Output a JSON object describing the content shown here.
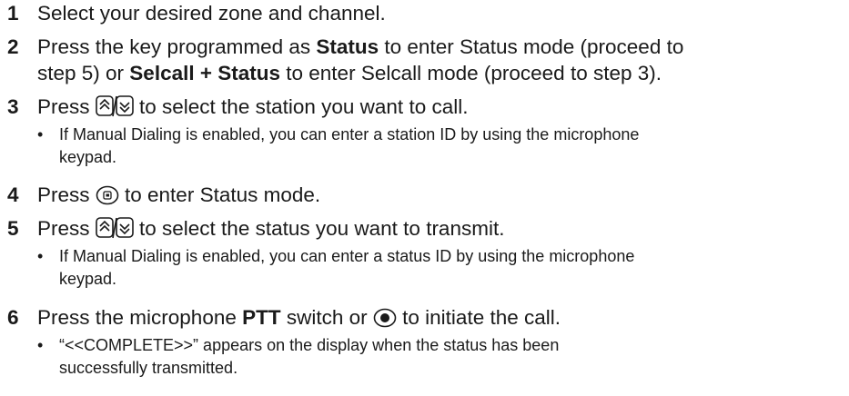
{
  "steps": [
    {
      "num": "1",
      "before": "Select your desired zone and channel."
    },
    {
      "num": "2",
      "before": "Press the key programmed as ",
      "bold1": "Status",
      "mid": " to enter Status mode (proceed to",
      "line2a": "step 5) or ",
      "bold2": "Selcall + Status",
      "line2b": " to enter Selcall mode (proceed to step 3)."
    },
    {
      "num": "3",
      "before": "Press ",
      "after": " to select the station you want to call.",
      "sub_line1": "If Manual Dialing is enabled, you can enter a station ID by using the microphone",
      "sub_line2": "keypad."
    },
    {
      "num": "4",
      "before": "Press ",
      "after": " to enter Status mode."
    },
    {
      "num": "5",
      "before": "Press ",
      "after": " to select the status you want to transmit.",
      "sub_line1": "If Manual Dialing is enabled, you can enter a status ID by using the microphone",
      "sub_line2": "keypad."
    },
    {
      "num": "6",
      "before": "Press the microphone ",
      "bold1": "PTT",
      "after": " switch or ",
      "after2": " to initiate the call.",
      "sub_line1": "“<<COMPLETE>>” appears on the display when the status has been",
      "sub_line2": "successfully transmitted."
    }
  ],
  "bullet": "•",
  "icons": {
    "up_down": "up-down-arrow-keys-icon",
    "enter": "enter-key-icon",
    "record": "record-button-icon"
  }
}
